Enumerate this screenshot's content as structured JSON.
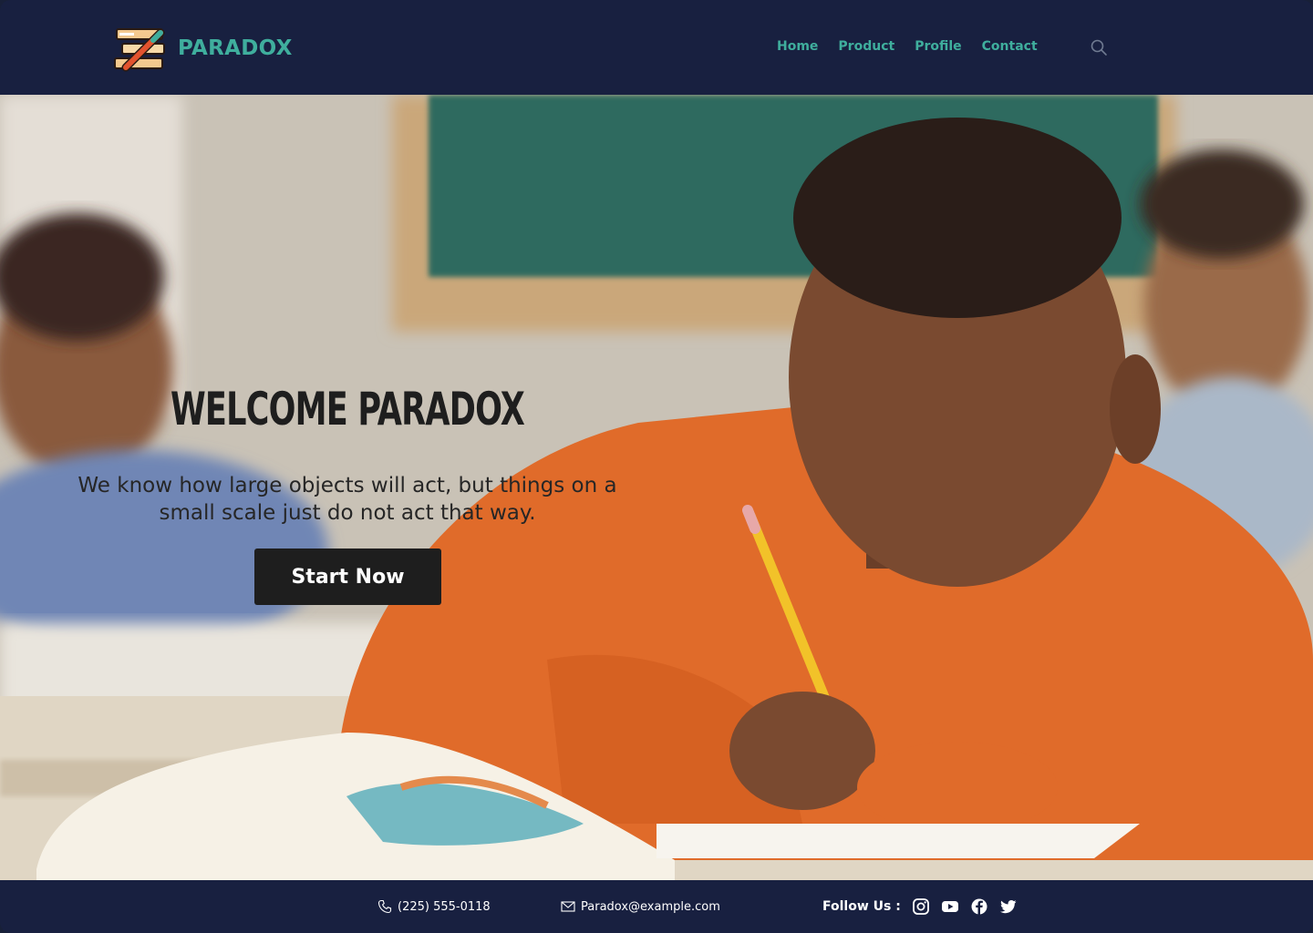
{
  "brand": {
    "name": "PARADOX",
    "logo_icon": "pencil-books-logo",
    "accent": "#3fae9d",
    "bg": "#182040"
  },
  "nav": {
    "items": [
      {
        "label": "Home"
      },
      {
        "label": "Product"
      },
      {
        "label": "Profile"
      },
      {
        "label": "Contact"
      }
    ],
    "search_icon": "search-icon"
  },
  "hero": {
    "title": "WELCOME PARADOX",
    "subtitle_line1": "We know how large objects will act, but things on a",
    "subtitle_line2": "small scale just do not act that way.",
    "cta": "Start Now",
    "image": "boy-writing-in-classroom-photo"
  },
  "footer": {
    "phone": "(225) 555-0118",
    "email": "Paradox@example.com",
    "follow_label": "Follow Us :",
    "socials": [
      "instagram-icon",
      "youtube-icon",
      "facebook-icon",
      "twitter-icon"
    ]
  }
}
